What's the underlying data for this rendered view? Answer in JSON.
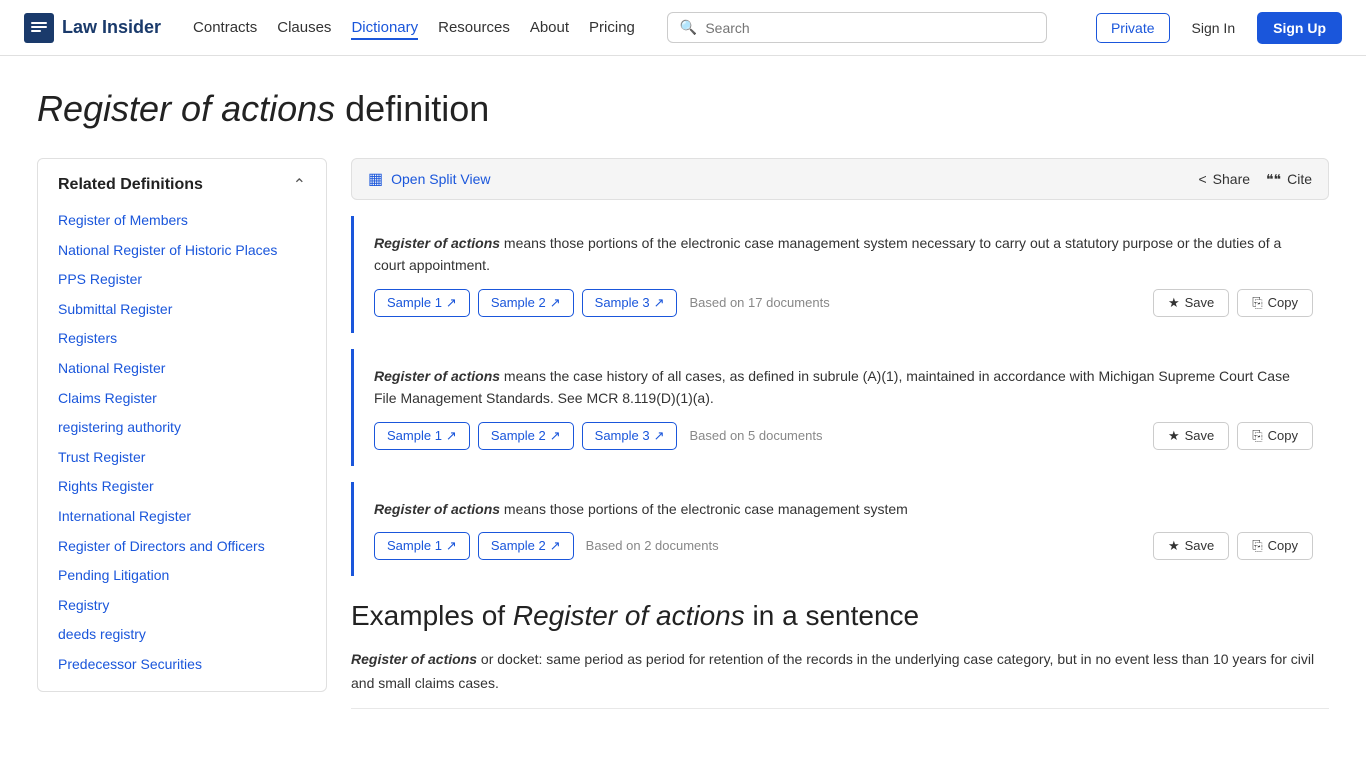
{
  "brand": {
    "icon": "≡",
    "name": "Law Insider"
  },
  "nav": {
    "links": [
      {
        "label": "Contracts",
        "active": false
      },
      {
        "label": "Clauses",
        "active": false
      },
      {
        "label": "Dictionary",
        "active": true
      },
      {
        "label": "Resources",
        "active": false
      },
      {
        "label": "About",
        "active": false
      },
      {
        "label": "Pricing",
        "active": false
      }
    ],
    "search_placeholder": "Search",
    "btn_private": "Private",
    "btn_signin": "Sign In",
    "btn_signup": "Sign Up"
  },
  "page": {
    "title_italic": "Register of actions",
    "title_rest": " definition"
  },
  "sidebar": {
    "title": "Related Definitions",
    "links": [
      "Register of Members",
      "National Register of Historic Places",
      "PPS Register",
      "Submittal Register",
      "Registers",
      "National Register",
      "Claims Register",
      "registering authority",
      "Trust Register",
      "Rights Register",
      "International Register",
      "Register of Directors and Officers",
      "Pending Litigation",
      "Registry",
      "deeds registry",
      "Predecessor Securities"
    ]
  },
  "toolbar": {
    "split_view_label": "Open Split View",
    "share_label": "Share",
    "cite_label": "Cite"
  },
  "definitions": [
    {
      "term": "Register of actions",
      "text": " means those portions of the electronic case management system necessary to carry out a statutory purpose or the duties of a court appointment.",
      "samples": [
        "Sample 1",
        "Sample 2",
        "Sample 3"
      ],
      "doc_count": "Based on 17 documents",
      "save_label": "Save",
      "copy_label": "Copy"
    },
    {
      "term": "Register of actions",
      "text": " means the case history of all cases, as defined in subrule (A)(1), maintained in accordance with Michigan Supreme Court Case File Management Standards. See MCR 8.119(D)(1)(a).",
      "samples": [
        "Sample 1",
        "Sample 2",
        "Sample 3"
      ],
      "doc_count": "Based on 5 documents",
      "save_label": "Save",
      "copy_label": "Copy"
    },
    {
      "term": "Register of actions",
      "text": " means those portions of the electronic case management system",
      "samples": [
        "Sample 1",
        "Sample 2"
      ],
      "doc_count": "Based on 2 documents",
      "save_label": "Save",
      "copy_label": "Copy"
    }
  ],
  "examples": {
    "title_prefix": "Examples of ",
    "title_term": "Register of actions",
    "title_suffix": " in a sentence",
    "items": [
      {
        "term": "Register of actions",
        "text": " or docket: same period as period for retention of the records in the underlying case category, but in no event less than 10 years for civil and small claims cases."
      }
    ]
  }
}
